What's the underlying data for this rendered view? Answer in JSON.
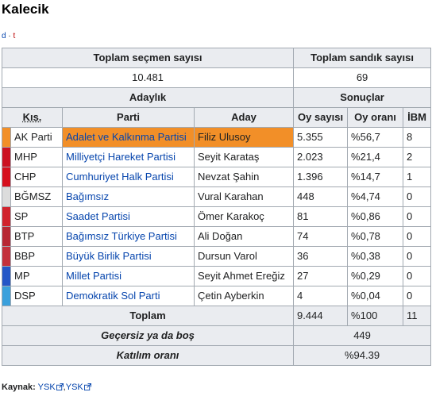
{
  "title": "Kalecik",
  "vte": {
    "d": "d",
    "sep": "·",
    "t": "t"
  },
  "header": {
    "voters_label": "Toplam seçmen sayısı",
    "boxes_label": "Toplam sandık sayısı",
    "voters_value": "10.481",
    "boxes_value": "69",
    "candidacy": "Adaylık",
    "results": "Sonuçlar",
    "col_abbr": "Kıs.",
    "col_party": "Parti",
    "col_candidate": "Aday",
    "col_votes": "Oy sayısı",
    "col_pct": "Oy oranı",
    "col_ibm": "İBM"
  },
  "rows": [
    {
      "abbr": "AK Parti",
      "color": "#f28f28",
      "party": "Adalet ve Kalkınma Partisi",
      "candidate": "Filiz Ulusoy",
      "votes": "5.355",
      "pct": "%56,7",
      "ibm": "8",
      "highlight": true
    },
    {
      "abbr": "MHP",
      "color": "#cc1222",
      "party": "Milliyetçi Hareket Partisi",
      "candidate": "Seyit Karataş",
      "votes": "2.023",
      "pct": "%21,4",
      "ibm": "2"
    },
    {
      "abbr": "CHP",
      "color": "#d6101e",
      "party": "Cumhuriyet Halk Partisi",
      "candidate": "Nevzat Şahin",
      "votes": "1.396",
      "pct": "%14,7",
      "ibm": "1"
    },
    {
      "abbr": "BĞMSZ",
      "color": "#dcdcdc",
      "party": "Bağımsız",
      "candidate": "Vural Karahan",
      "votes": "448",
      "pct": "%4,74",
      "ibm": "0"
    },
    {
      "abbr": "SP",
      "color": "#d1232d",
      "party": "Saadet Partisi",
      "candidate": "Ömer Karakoç",
      "votes": "81",
      "pct": "%0,86",
      "ibm": "0"
    },
    {
      "abbr": "BTP",
      "color": "#b82733",
      "party": "Bağımsız Türkiye Partisi",
      "candidate": "Ali Doğan",
      "votes": "74",
      "pct": "%0,78",
      "ibm": "0"
    },
    {
      "abbr": "BBP",
      "color": "#c4313c",
      "party": "Büyük Birlik Partisi",
      "candidate": "Dursun Varol",
      "votes": "36",
      "pct": "%0,38",
      "ibm": "0"
    },
    {
      "abbr": "MP",
      "color": "#2456c7",
      "party": "Millet Partisi",
      "candidate": "Seyit Ahmet Ereğiz",
      "votes": "27",
      "pct": "%0,29",
      "ibm": "0"
    },
    {
      "abbr": "DSP",
      "color": "#3aa0dc",
      "party": "Demokratik Sol Parti",
      "candidate": "Çetin Ayberkin",
      "votes": "4",
      "pct": "%0,04",
      "ibm": "0"
    }
  ],
  "totals": {
    "label": "Toplam",
    "votes": "9.444",
    "pct": "%100",
    "ibm": "11",
    "invalid_label": "Geçersiz ya da boş",
    "invalid_value": "449",
    "turnout_label": "Katılım oranı",
    "turnout_value": "%94.39"
  },
  "source": {
    "label": "Kaynak:",
    "link1": "YSK",
    "sep": ",",
    "link2": "YSK"
  }
}
